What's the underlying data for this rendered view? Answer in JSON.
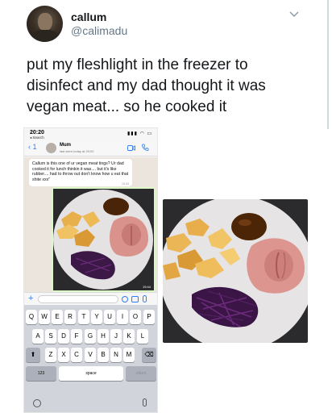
{
  "tweet": {
    "display_name": "callum",
    "handle": "@calimadu",
    "text": "put my fleshlight in the freezer to disinfect and my dad thought it was vegan meat... so he cooked it"
  },
  "screenshot": {
    "status": {
      "time": "20:20",
      "search_label": "◂ Search",
      "icons": "▮▮▮ ◠ ▭"
    },
    "chat_header": {
      "back_label": "‹ 1",
      "contact_name": "Mum",
      "last_seen": "last seen today at 20:02"
    },
    "message": {
      "text": "Callum is this one of ur vegan meat tings? Ur dad cooked it for lunch thinkin it was.... but it's like rubber.... had to throw out don't know how u eat that shite xxx\"",
      "time": "19:43"
    },
    "image_message_time": "19:44",
    "input": {
      "plus_label": "+"
    },
    "keyboard": {
      "row1": [
        "Q",
        "W",
        "E",
        "R",
        "T",
        "Y",
        "U",
        "I",
        "O",
        "P"
      ],
      "row2": [
        "A",
        "S",
        "D",
        "F",
        "G",
        "H",
        "J",
        "K",
        "L"
      ],
      "row3": [
        "Z",
        "X",
        "C",
        "V",
        "B",
        "N",
        "M"
      ],
      "shift": "⬆",
      "delete": "⌫",
      "numbers": "123",
      "space": "space",
      "return": "return"
    }
  },
  "icons": [
    "chevron-down-icon",
    "video-call-icon",
    "phone-call-icon",
    "forward-icon",
    "sticker-icon",
    "camera-icon",
    "mic-icon",
    "emoji-icon",
    "dictation-icon"
  ],
  "colors": {
    "twitter_text": "#14171a",
    "twitter_secondary": "#657786",
    "ios_blue": "#2e7cf6",
    "chat_bg": "#ece5dd",
    "keyboard_bg": "#d1d4da"
  }
}
